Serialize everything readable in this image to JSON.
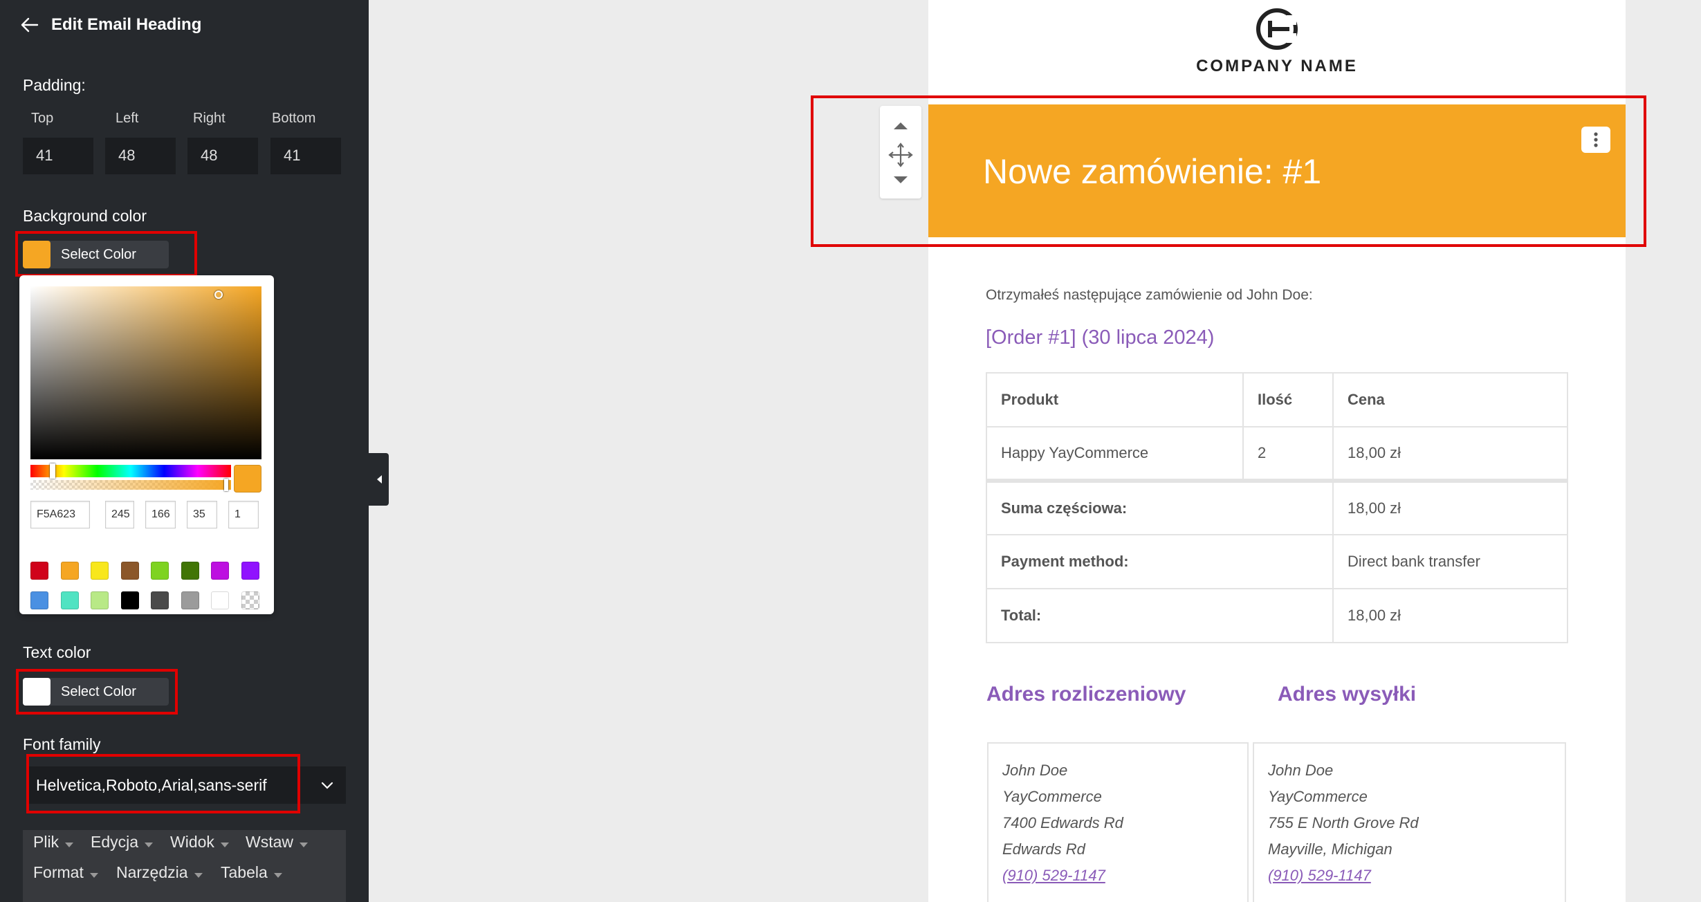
{
  "sidebar": {
    "title": "Edit Email Heading",
    "padding": {
      "label": "Padding:",
      "top_label": "Top",
      "top_value": "41",
      "left_label": "Left",
      "left_value": "48",
      "right_label": "Right",
      "right_value": "48",
      "bottom_label": "Bottom",
      "bottom_value": "41"
    },
    "background_color": {
      "label": "Background color",
      "button_label": "Select Color",
      "color": "#f5a623"
    },
    "color_picker": {
      "hex": "F5A623",
      "r": "245",
      "g": "166",
      "b": "35",
      "a": "1",
      "swatches": [
        "#d0021b",
        "#f5a623",
        "#f8e71c",
        "#8b572a",
        "#7ed321",
        "#417505",
        "#bd10e0",
        "#9013fe",
        "#4a90e2",
        "#50e3c2",
        "#b8e986",
        "#000000",
        "#4a4a4a",
        "#9b9b9b",
        "#ffffff",
        "transparent"
      ]
    },
    "text_color": {
      "label": "Text color",
      "button_label": "Select Color",
      "color": "#ffffff"
    },
    "font_family": {
      "label": "Font family",
      "value": "Helvetica,Roboto,Arial,sans-serif"
    },
    "menubar": [
      "Plik",
      "Edycja",
      "Widok",
      "Wstaw",
      "Format",
      "Narzędzia",
      "Tabela"
    ]
  },
  "email": {
    "company_name": "COMPANY NAME",
    "heading": "Nowe zamówienie: #1",
    "heading_bg": "#f5a623",
    "intro": "Otrzymałeś następujące zamówienie od John Doe:",
    "order_link": "[Order #1] (30 lipca 2024)",
    "table": {
      "headers": [
        "Produkt",
        "Ilość",
        "Cena"
      ],
      "item": {
        "product": "Happy YayCommerce",
        "qty": "2",
        "price": "18,00 zł"
      },
      "subtotal_label": "Suma częściowa:",
      "subtotal_value": "18,00 zł",
      "payment_label": "Payment method:",
      "payment_value": "Direct bank transfer",
      "total_label": "Total:",
      "total_value": "18,00 zł"
    },
    "billing": {
      "title": "Adres rozliczeniowy",
      "lines": [
        "John Doe",
        "YayCommerce",
        "7400 Edwards Rd",
        "Edwards Rd"
      ],
      "phone": "(910) 529-1147"
    },
    "shipping": {
      "title": "Adres wysyłki",
      "lines": [
        "John Doe",
        "YayCommerce",
        "755 E North Grove Rd",
        "Mayville, Michigan"
      ],
      "phone": "(910) 529-1147"
    },
    "accent_color": "#8a5bb8"
  }
}
